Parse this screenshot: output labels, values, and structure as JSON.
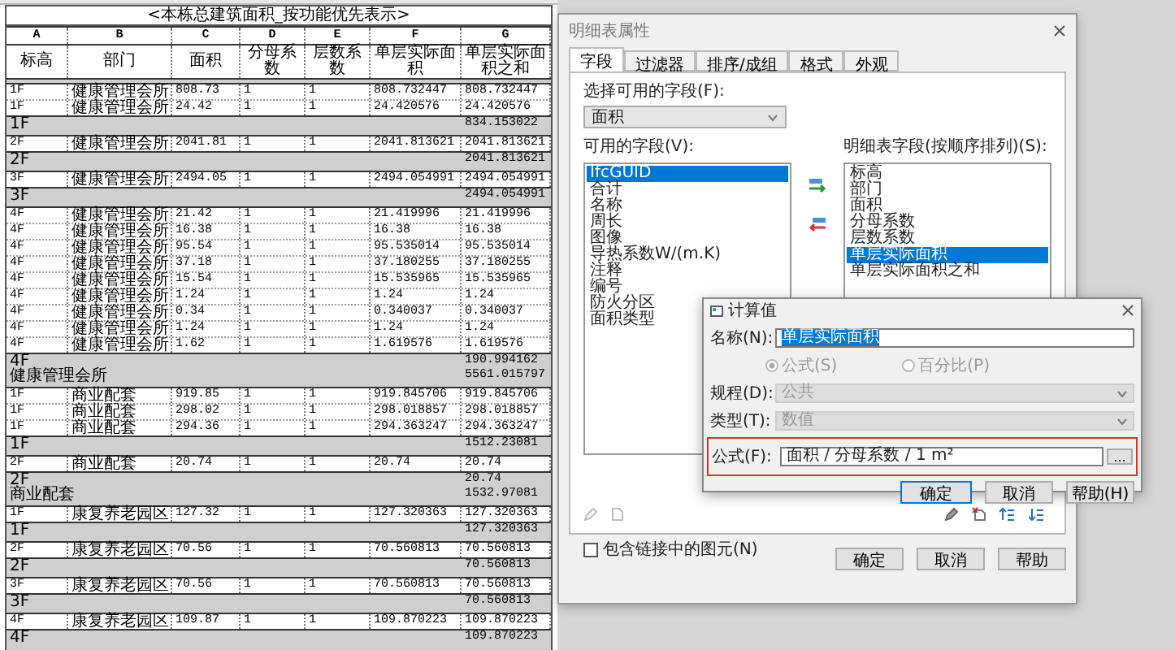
{
  "schedule": {
    "title": "<本栋总建筑面积_按功能优先表示>",
    "column_letters": [
      "A",
      "B",
      "C",
      "D",
      "E",
      "F",
      "G"
    ],
    "headers": [
      "标高",
      "部门",
      "面积",
      "分母系数",
      "层数系数",
      "单层实际面积",
      "单层实际面积之和"
    ],
    "rows": [
      {
        "kind": "blank"
      },
      {
        "kind": "data",
        "cells": [
          "1F",
          "健康管理会所",
          "808.73",
          "1",
          "1",
          "808.732447",
          "808.732447"
        ]
      },
      {
        "kind": "data",
        "cells": [
          "1F",
          "健康管理会所",
          "24.42",
          "1",
          "1",
          "24.420576",
          "24.420576"
        ]
      },
      {
        "kind": "group",
        "lines": [
          {
            "label": "1F",
            "total": "834.153022"
          }
        ]
      },
      {
        "kind": "blank"
      },
      {
        "kind": "data",
        "cells": [
          "2F",
          "健康管理会所",
          "2041.81",
          "1",
          "1",
          "2041.813621",
          "2041.813621"
        ]
      },
      {
        "kind": "group",
        "lines": [
          {
            "label": "2F",
            "total": "2041.813621"
          }
        ]
      },
      {
        "kind": "blank"
      },
      {
        "kind": "data",
        "cells": [
          "3F",
          "健康管理会所",
          "2494.05",
          "1",
          "1",
          "2494.054991",
          "2494.054991"
        ]
      },
      {
        "kind": "group",
        "lines": [
          {
            "label": "3F",
            "total": "2494.054991"
          }
        ]
      },
      {
        "kind": "blank"
      },
      {
        "kind": "data",
        "cells": [
          "4F",
          "健康管理会所",
          "21.42",
          "1",
          "1",
          "21.419996",
          "21.419996"
        ]
      },
      {
        "kind": "data",
        "cells": [
          "4F",
          "健康管理会所",
          "16.38",
          "1",
          "1",
          "16.38",
          "16.38"
        ]
      },
      {
        "kind": "data",
        "cells": [
          "4F",
          "健康管理会所",
          "95.54",
          "1",
          "1",
          "95.535014",
          "95.535014"
        ]
      },
      {
        "kind": "data",
        "cells": [
          "4F",
          "健康管理会所",
          "37.18",
          "1",
          "1",
          "37.180255",
          "37.180255"
        ]
      },
      {
        "kind": "data",
        "cells": [
          "4F",
          "健康管理会所",
          "15.54",
          "1",
          "1",
          "15.535965",
          "15.535965"
        ]
      },
      {
        "kind": "data",
        "cells": [
          "4F",
          "健康管理会所",
          "1.24",
          "1",
          "1",
          "1.24",
          "1.24"
        ]
      },
      {
        "kind": "data",
        "cells": [
          "4F",
          "健康管理会所",
          "0.34",
          "1",
          "1",
          "0.340037",
          "0.340037"
        ]
      },
      {
        "kind": "data",
        "cells": [
          "4F",
          "健康管理会所",
          "1.24",
          "1",
          "1",
          "1.24",
          "1.24"
        ]
      },
      {
        "kind": "data",
        "cells": [
          "4F",
          "健康管理会所",
          "1.62",
          "1",
          "1",
          "1.619576",
          "1.619576"
        ]
      },
      {
        "kind": "group",
        "lines": [
          {
            "label": "4F",
            "total": "190.994162"
          },
          {
            "label": "健康管理会所",
            "total": "5561.015797"
          }
        ]
      },
      {
        "kind": "blank"
      },
      {
        "kind": "data",
        "cells": [
          "1F",
          "商业配套",
          "919.85",
          "1",
          "1",
          "919.845706",
          "919.845706"
        ]
      },
      {
        "kind": "data",
        "cells": [
          "1F",
          "商业配套",
          "298.02",
          "1",
          "1",
          "298.018857",
          "298.018857"
        ]
      },
      {
        "kind": "data",
        "cells": [
          "1F",
          "商业配套",
          "294.36",
          "1",
          "1",
          "294.363247",
          "294.363247"
        ]
      },
      {
        "kind": "group",
        "lines": [
          {
            "label": "1F",
            "total": "1512.23081"
          }
        ]
      },
      {
        "kind": "blank"
      },
      {
        "kind": "data",
        "cells": [
          "2F",
          "商业配套",
          "20.74",
          "1",
          "1",
          "20.74",
          "20.74"
        ]
      },
      {
        "kind": "group",
        "lines": [
          {
            "label": "2F",
            "total": "20.74"
          },
          {
            "label": "商业配套",
            "total": "1532.97081"
          }
        ]
      },
      {
        "kind": "blank"
      },
      {
        "kind": "data",
        "cells": [
          "1F",
          "康复养老园区",
          "127.32",
          "1",
          "1",
          "127.320363",
          "127.320363"
        ]
      },
      {
        "kind": "group",
        "lines": [
          {
            "label": "1F",
            "total": "127.320363"
          }
        ]
      },
      {
        "kind": "blank"
      },
      {
        "kind": "data",
        "cells": [
          "2F",
          "康复养老园区",
          "70.56",
          "1",
          "1",
          "70.560813",
          "70.560813"
        ]
      },
      {
        "kind": "group",
        "lines": [
          {
            "label": "2F",
            "total": "70.560813"
          }
        ]
      },
      {
        "kind": "blank"
      },
      {
        "kind": "data",
        "cells": [
          "3F",
          "康复养老园区",
          "70.56",
          "1",
          "1",
          "70.560813",
          "70.560813"
        ]
      },
      {
        "kind": "group",
        "lines": [
          {
            "label": "3F",
            "total": "70.560813"
          }
        ]
      },
      {
        "kind": "blank"
      },
      {
        "kind": "data",
        "cells": [
          "4F",
          "康复养老园区",
          "109.87",
          "1",
          "1",
          "109.870223",
          "109.870223"
        ]
      },
      {
        "kind": "group",
        "lines": [
          {
            "label": "4F",
            "total": "109.870223"
          }
        ]
      }
    ]
  },
  "properties_dialog": {
    "title": "明细表属性",
    "tabs": [
      {
        "label": "字段",
        "selected": true
      },
      {
        "label": "过滤器",
        "selected": false
      },
      {
        "label": "排序/成组",
        "selected": false
      },
      {
        "label": "格式",
        "selected": false
      },
      {
        "label": "外观",
        "selected": false
      }
    ],
    "field_source": {
      "label": "选择可用的字段(F):",
      "value": "面积"
    },
    "available": {
      "label": "可用的字段(V):",
      "items": [
        {
          "label": "IfcGUID",
          "selected": true
        },
        {
          "label": "合计",
          "selected": false
        },
        {
          "label": "名称",
          "selected": false
        },
        {
          "label": "周长",
          "selected": false
        },
        {
          "label": "图像",
          "selected": false
        },
        {
          "label": "导热系数W/(m.K)",
          "selected": false
        },
        {
          "label": "注释",
          "selected": false
        },
        {
          "label": "编号",
          "selected": false
        },
        {
          "label": "防火分区",
          "selected": false
        },
        {
          "label": "面积类型",
          "selected": false
        }
      ]
    },
    "scheduled": {
      "label": "明细表字段(按顺序排列)(S):",
      "items": [
        {
          "label": "标高",
          "selected": false
        },
        {
          "label": "部门",
          "selected": false
        },
        {
          "label": "面积",
          "selected": false
        },
        {
          "label": "分母系数",
          "selected": false
        },
        {
          "label": "层数系数",
          "selected": false
        },
        {
          "label": "单层实际面积",
          "selected": true
        },
        {
          "label": "单层实际面积之和",
          "selected": false
        }
      ]
    },
    "include_linked": {
      "label": "包含链接中的图元(N)",
      "checked": false
    },
    "buttons": [
      "确定",
      "取消",
      "帮助"
    ]
  },
  "calc_dialog": {
    "title": "计算值",
    "name": {
      "label": "名称(N):",
      "value": "单层实际面积"
    },
    "modes": [
      {
        "label": "公式(S)",
        "selected": true,
        "disabled": true
      },
      {
        "label": "百分比(P)",
        "selected": false,
        "disabled": true
      }
    ],
    "discipline": {
      "label": "规程(D):",
      "value": "公共",
      "disabled": true
    },
    "type": {
      "label": "类型(T):",
      "value": "数值",
      "disabled": true
    },
    "formula": {
      "label": "公式(F):",
      "value": "面积 / 分母系数 / 1 m²",
      "highlighted": true
    },
    "browse": "...",
    "buttons": [
      "确定",
      "取消",
      "帮助(H)"
    ]
  }
}
